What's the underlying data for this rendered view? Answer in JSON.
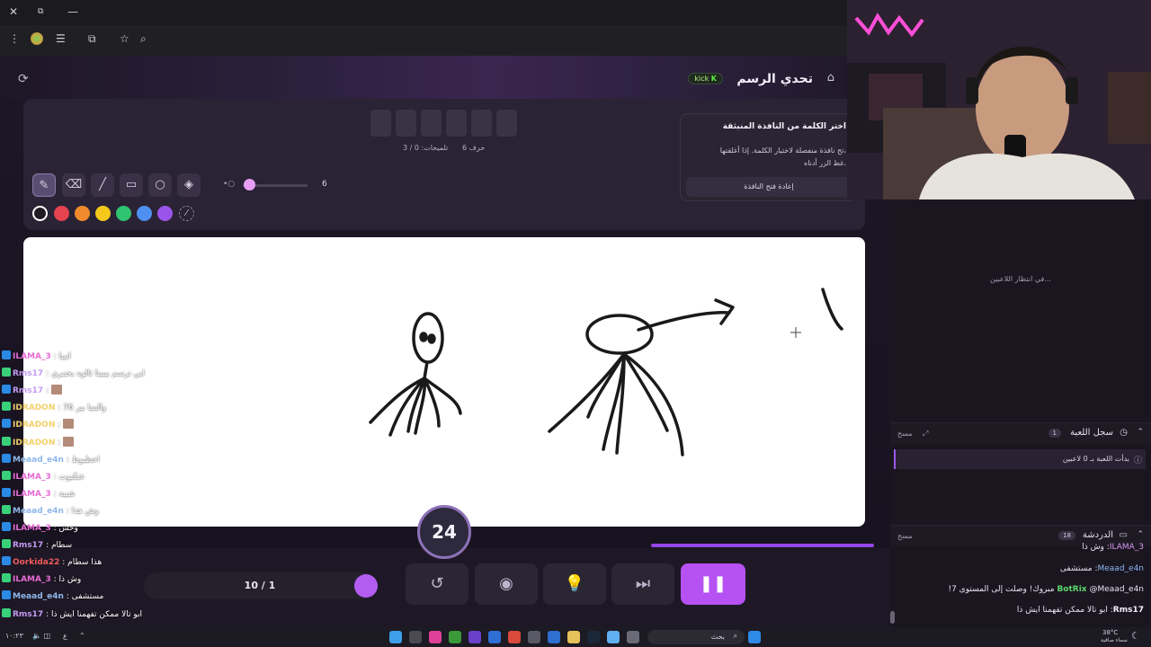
{
  "browser": {
    "controls": [
      "✕",
      "⧉",
      "—"
    ],
    "address_icons": [
      "⋮",
      "tab-icon",
      "filter-icon",
      "extensions-icon",
      "star-icon",
      "search-icon"
    ]
  },
  "app": {
    "title": "تحدي الرسم",
    "platform_badge": "kick",
    "word": {
      "letters_label": "6 حرف",
      "hints_label": "تلميحات: 0 / 3",
      "slot_count": 6
    },
    "brush_size": "6",
    "tools": [
      "pen",
      "eraser",
      "line",
      "rectangle",
      "circle",
      "fill"
    ],
    "colors": [
      "#1f1b26",
      "#e4434f",
      "#f08a2c",
      "#f4c91c",
      "#2fc46f",
      "#4f8ff0",
      "#9a54ea"
    ],
    "popup": {
      "title": "اختر الكلمة من النافذة المنبثقة",
      "body_line1": "تح نافذة منفصلة لاختيار الكلمة. إذا أغلقتها،",
      "body_line2": "غط الزر أدناه.",
      "button": "إعادة فتح النافذة"
    },
    "timer": "24",
    "round": "10 / 1",
    "round_progress": 0.28
  },
  "right_panel": {
    "waiting": "في انتظار اللاعبين...",
    "game_log": {
      "title": "سجل اللعبة",
      "count": "1",
      "clear": "مسح",
      "entry": "بدأت اللعبة بـ 0 لاعبين"
    },
    "chat": {
      "title": "الدردشة",
      "count": "18",
      "clear": "مسح",
      "messages": [
        {
          "user": "ILAMA_3",
          "text": "وش ذا"
        },
        {
          "user": "Meaad_e4n",
          "text": "مستشفى"
        },
        {
          "user": "BotRix",
          "text": "@Meaad_e4n مبروك! وصلت إلى المستوى 7!"
        },
        {
          "user": "Rms17",
          "text": "ابو تالا ممكن تفهمنا ايش ذا"
        }
      ]
    }
  },
  "overlay_chat": [
    {
      "user": "ILAMA_3",
      "text": "انيبا",
      "color": "#e76bd5"
    },
    {
      "user": "Rms17",
      "text": "ايي ترسم بيبينا ثالوه بحمري",
      "color": "#c39af0"
    },
    {
      "user": "Rms17",
      "text": "",
      "color": "#c39af0"
    },
    {
      "user": "IDRADON",
      "text": "والبنيا بير 76",
      "color": "#f4d06a"
    },
    {
      "user": "IDRADON",
      "text": "",
      "color": "#f4d06a"
    },
    {
      "user": "IDRADON",
      "text": "",
      "color": "#f4d06a"
    },
    {
      "user": "Meaad_e4n",
      "text": "اخطبوط",
      "color": "#8fb6ea"
    },
    {
      "user": "ILAMA_3",
      "text": "عنكبوت",
      "color": "#e76bd5"
    },
    {
      "user": "ILAMA_3",
      "text": "شيبة",
      "color": "#e76bd5"
    },
    {
      "user": "Meaad_e4n",
      "text": "وش هذا",
      "color": "#8fb6ea"
    },
    {
      "user": "ILAMA_3",
      "text": "وحش",
      "color": "#e76bd5"
    },
    {
      "user": "Rms17",
      "text": "سطام",
      "color": "#c39af0"
    },
    {
      "user": "Oorkida22",
      "text": "هذا سطام",
      "color": "#ef5b5b"
    },
    {
      "user": "ILAMA_3",
      "text": "وش ذا",
      "color": "#e76bd5"
    },
    {
      "user": "Meaad_e4n",
      "text": "مستشفى",
      "color": "#8fb6ea"
    },
    {
      "user": "Rms17",
      "text": "ابو تالا ممكن تفهمنا ايش ذا",
      "color": "#c39af0"
    }
  ],
  "taskbar": {
    "search": "بحث",
    "weather": "38°C",
    "weather_desc": "سماء صافية",
    "time": "١٠:٢٣",
    "lang": "ع"
  }
}
